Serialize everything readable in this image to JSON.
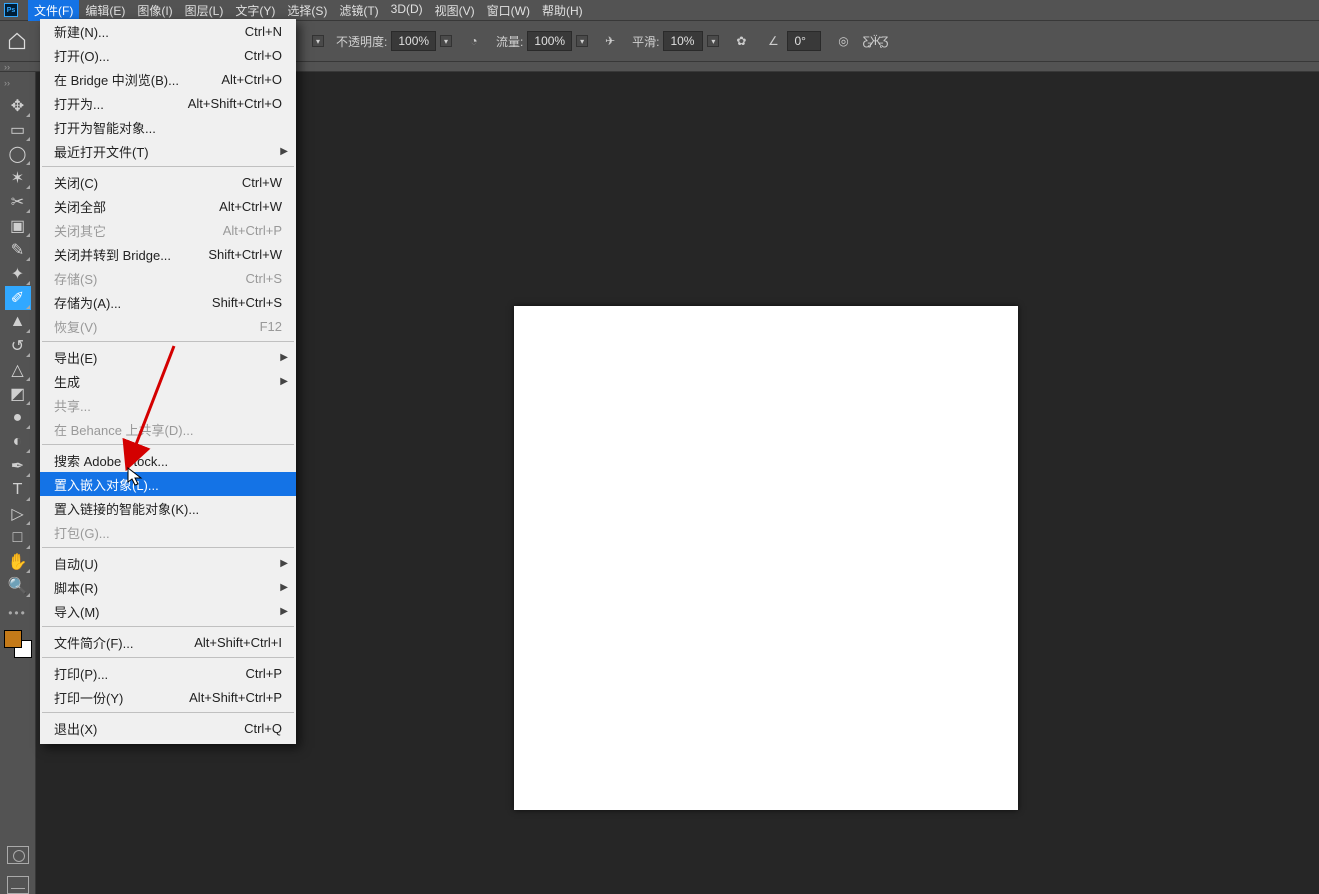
{
  "menubar": {
    "items": [
      "文件(F)",
      "编辑(E)",
      "图像(I)",
      "图层(L)",
      "文字(Y)",
      "选择(S)",
      "滤镜(T)",
      "3D(D)",
      "视图(V)",
      "窗口(W)",
      "帮助(H)"
    ],
    "active_index": 0
  },
  "optionsbar": {
    "opacity_label": "不透明度:",
    "opacity_value": "100%",
    "flow_label": "流量:",
    "flow_value": "100%",
    "smooth_label": "平滑:",
    "smooth_value": "10%",
    "angle_value": "0°"
  },
  "tools": [
    {
      "name": "move-tool",
      "glyph": "✥"
    },
    {
      "name": "marquee-tool",
      "glyph": "▭"
    },
    {
      "name": "lasso-tool",
      "glyph": "◯"
    },
    {
      "name": "quick-select-tool",
      "glyph": "✶"
    },
    {
      "name": "crop-tool",
      "glyph": "✂"
    },
    {
      "name": "frame-tool",
      "glyph": "▣"
    },
    {
      "name": "eyedropper-tool",
      "glyph": "✎"
    },
    {
      "name": "spot-heal-tool",
      "glyph": "✦"
    },
    {
      "name": "brush-tool",
      "glyph": "✐",
      "active": true
    },
    {
      "name": "clone-stamp-tool",
      "glyph": "▲"
    },
    {
      "name": "history-brush-tool",
      "glyph": "↺"
    },
    {
      "name": "eraser-tool",
      "glyph": "△"
    },
    {
      "name": "gradient-tool",
      "glyph": "◩"
    },
    {
      "name": "blur-tool",
      "glyph": "●"
    },
    {
      "name": "dodge-tool",
      "glyph": "◐"
    },
    {
      "name": "pen-tool",
      "glyph": "✒"
    },
    {
      "name": "type-tool",
      "glyph": "T"
    },
    {
      "name": "path-select-tool",
      "glyph": "▷"
    },
    {
      "name": "rectangle-tool",
      "glyph": "□"
    },
    {
      "name": "hand-tool",
      "glyph": "✋"
    },
    {
      "name": "zoom-tool",
      "glyph": "🔍"
    }
  ],
  "file_menu": [
    {
      "label": "新建(N)...",
      "short": "Ctrl+N"
    },
    {
      "label": "打开(O)...",
      "short": "Ctrl+O"
    },
    {
      "label": "在 Bridge 中浏览(B)...",
      "short": "Alt+Ctrl+O"
    },
    {
      "label": "打开为...",
      "short": "Alt+Shift+Ctrl+O"
    },
    {
      "label": "打开为智能对象..."
    },
    {
      "label": "最近打开文件(T)",
      "sub": true
    },
    {
      "sep": true
    },
    {
      "label": "关闭(C)",
      "short": "Ctrl+W"
    },
    {
      "label": "关闭全部",
      "short": "Alt+Ctrl+W"
    },
    {
      "label": "关闭其它",
      "short": "Alt+Ctrl+P",
      "disabled": true
    },
    {
      "label": "关闭并转到 Bridge...",
      "short": "Shift+Ctrl+W"
    },
    {
      "label": "存储(S)",
      "short": "Ctrl+S",
      "disabled": true
    },
    {
      "label": "存储为(A)...",
      "short": "Shift+Ctrl+S"
    },
    {
      "label": "恢复(V)",
      "short": "F12",
      "disabled": true
    },
    {
      "sep": true
    },
    {
      "label": "导出(E)",
      "sub": true
    },
    {
      "label": "生成",
      "sub": true
    },
    {
      "label": "共享...",
      "disabled": true
    },
    {
      "label": "在 Behance 上共享(D)...",
      "disabled": true
    },
    {
      "sep": true
    },
    {
      "label": "搜索 Adobe Stock..."
    },
    {
      "label": "置入嵌入对象(L)...",
      "hover": true
    },
    {
      "label": "置入链接的智能对象(K)..."
    },
    {
      "label": "打包(G)...",
      "disabled": true
    },
    {
      "sep": true
    },
    {
      "label": "自动(U)",
      "sub": true
    },
    {
      "label": "脚本(R)",
      "sub": true
    },
    {
      "label": "导入(M)",
      "sub": true
    },
    {
      "sep": true
    },
    {
      "label": "文件简介(F)...",
      "short": "Alt+Shift+Ctrl+I"
    },
    {
      "sep": true
    },
    {
      "label": "打印(P)...",
      "short": "Ctrl+P"
    },
    {
      "label": "打印一份(Y)",
      "short": "Alt+Shift+Ctrl+P"
    },
    {
      "sep": true
    },
    {
      "label": "退出(X)",
      "short": "Ctrl+Q"
    }
  ]
}
